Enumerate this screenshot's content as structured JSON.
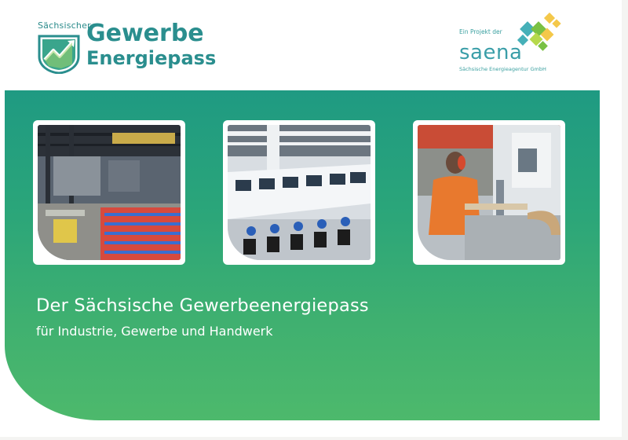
{
  "logo": {
    "small": "Sächsischer",
    "line1": "Gewerbe",
    "line2": "Energiepass",
    "icon": "chart-arrow-icon"
  },
  "partner": {
    "tagline": "Ein Projekt der",
    "name": "saena",
    "subtitle": "Sächsische Energieagentur GmbH",
    "icon": "diamond-cluster-icon"
  },
  "photos": [
    {
      "label": "industrial-hall"
    },
    {
      "label": "textile-machines"
    },
    {
      "label": "woodworking"
    }
  ],
  "headline": "Der Sächsische Gewerbeenergiepass",
  "subline": "für Industrie, Gewerbe und Handwerk",
  "colors": {
    "brand_teal": "#2a8e8e",
    "band_top": "#1f9a82",
    "band_bottom": "#4db96c"
  }
}
